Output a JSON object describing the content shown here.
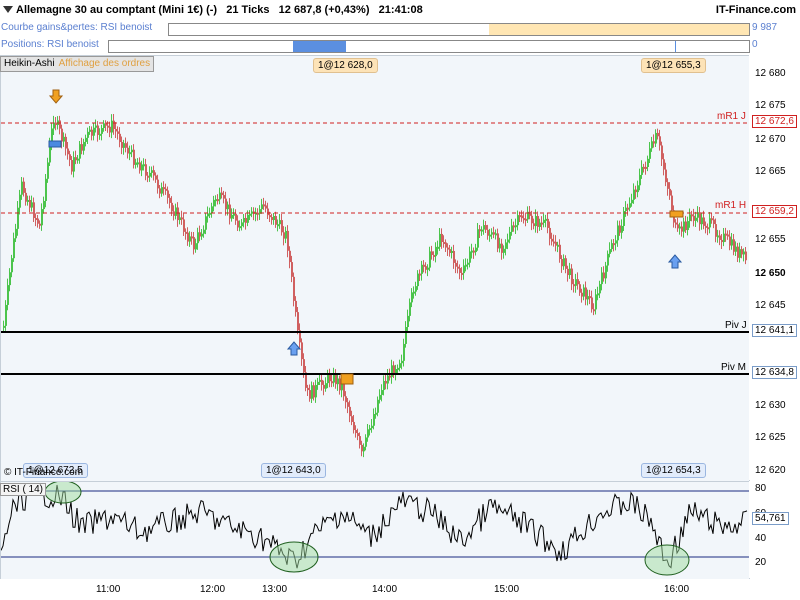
{
  "title": {
    "instrument": "Allemagne 30 au comptant (Mini 1€) (-)",
    "ticks": "21 Ticks",
    "quote": "12 687,8 (+0,43%)",
    "time": "21:41:08",
    "brand": "IT-Finance.com"
  },
  "strips": {
    "equity_label": "Courbe gains&pertes: RSI benoist",
    "equity_value": "9 987",
    "positions_label": "Positions: RSI benoist",
    "positions_value": "0"
  },
  "chart": {
    "style_button": "Heikin-Ashi",
    "style_sub": "Affichage des ordres",
    "copyright": "© IT-Finance.com",
    "bottom_left_label": "1@12 672,5",
    "top_labels": [
      "1@12 628,0",
      "1@12 655,3"
    ],
    "bottom_labels": [
      "1@12 643,0",
      "1@12 654,3"
    ],
    "price_ticks": [
      "12 680",
      "12 675",
      "12 670",
      "12 665",
      "12 660",
      "12 655",
      "12 650",
      "12 645",
      "12 640",
      "12 635",
      "12 630",
      "12 625",
      "12 620"
    ],
    "last_price": "12 650",
    "levels": [
      {
        "name": "mR1 J",
        "value": "12 672,6",
        "color": "#d02020"
      },
      {
        "name": "mR1 H",
        "value": "12 659,2",
        "color": "#d02020"
      },
      {
        "name": "Piv J",
        "value": "12 641,1",
        "color": "#000000"
      },
      {
        "name": "Piv M",
        "value": "12 634,8",
        "color": "#000000"
      }
    ],
    "up_color": "#4cc44c",
    "down_color": "#d06060"
  },
  "rsi": {
    "label": "RSI ( 14)",
    "ticks": [
      "80",
      "60",
      "40",
      "20"
    ],
    "value": "54,761"
  },
  "time_axis": [
    "11:00",
    "12:00",
    "13:00",
    "14:00",
    "15:00",
    "16:00"
  ]
}
